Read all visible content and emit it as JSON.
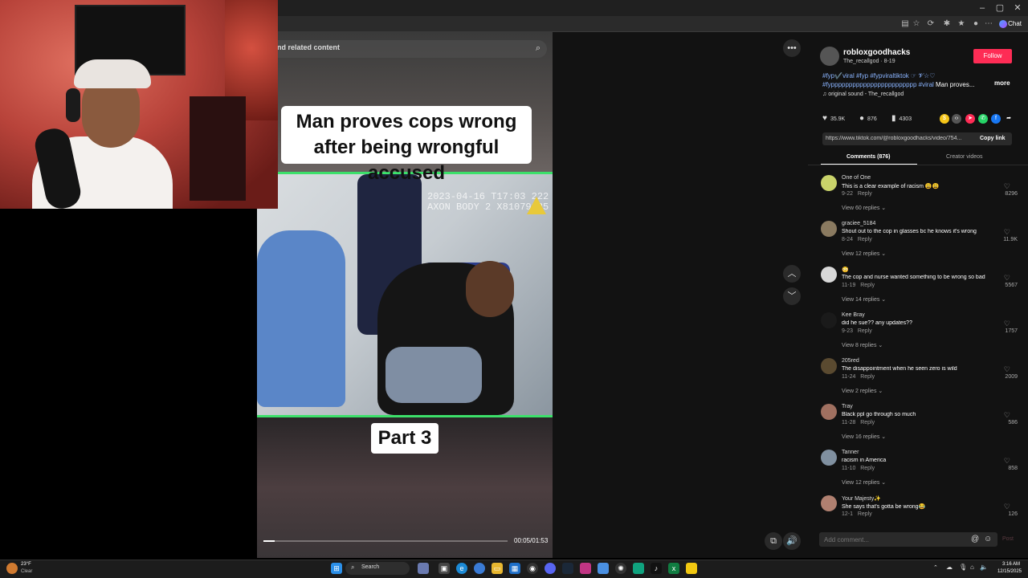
{
  "browser": {
    "chat_label": "Chat",
    "win_minimize": "–",
    "win_maximize": "▢",
    "win_close": "✕"
  },
  "search": {
    "label": "nd related content"
  },
  "video": {
    "caption_top": "Man proves cops wrong after being wrongful accused",
    "caption_bottom": "Part 3",
    "camera_stamp_line1": "2023-04-16  T17:03 222",
    "camera_stamp_line2": "AXON BODY 2  X81079335",
    "timecode": "00:05/01:53",
    "progress_fraction": 0.045
  },
  "author": {
    "name": "robloxgoodhacks",
    "sub": "The_recallgod · 8-19",
    "follow_label": "Follow"
  },
  "description": {
    "tags_line1": "#fyp✔️viral #fyp #fypviraltiktok ☞ 𝓥☆♡",
    "tags_line2": "#fypppppppppppppppppppppppp #viral",
    "tail": " Man proves...",
    "more": "more"
  },
  "sound": "♫  original sound - The_recallgod",
  "stats": {
    "likes": "35.9K",
    "comments": "876",
    "saves": "4303"
  },
  "share": {
    "url": "https://www.tiktok.com/@robloxgoodhacks/video/754...",
    "copy_label": "Copy link"
  },
  "tabs": {
    "comments": "Comments (876)",
    "creator": "Creator videos"
  },
  "comments": [
    {
      "user": "One of One",
      "text": "This is a clear example of racism 😩😩",
      "date": "9-22",
      "reply": "Reply",
      "replies": "View 60 replies ⌄",
      "likes": "8296",
      "avatar_color": "#c9d36a"
    },
    {
      "user": "graciee_5184",
      "text": "Shout out to the cop in glasses bc he knows it's wrong",
      "date": "8-24",
      "reply": "Reply",
      "replies": "View 12 replies ⌄",
      "likes": "11.9K",
      "avatar_color": "#8a7a60"
    },
    {
      "user": "😳",
      "text": "The cop and nurse wanted something to be wrong so bad",
      "date": "11-19",
      "reply": "Reply",
      "replies": "View 14 replies ⌄",
      "likes": "5567",
      "avatar_color": "#d8d8d8"
    },
    {
      "user": "Kee Bray",
      "text": "did he sue?? any updates??",
      "date": "9-23",
      "reply": "Reply",
      "replies": "View 8 replies ⌄",
      "likes": "1757",
      "avatar_color": "#1a1a1a"
    },
    {
      "user": "205red",
      "text": "The disappointment when he seen zero is wild",
      "date": "11-24",
      "reply": "Reply",
      "replies": "View 2 replies ⌄",
      "likes": "2009",
      "avatar_color": "#5a4a30"
    },
    {
      "user": "Tray",
      "text": "Black ppl go through so much",
      "date": "11-28",
      "reply": "Reply",
      "replies": "View 16 replies ⌄",
      "likes": "586",
      "avatar_color": "#a07060"
    },
    {
      "user": "Tanner",
      "text": "racism in America",
      "date": "11-10",
      "reply": "Reply",
      "replies": "View 12 replies ⌄",
      "likes": "858",
      "avatar_color": "#8090a0"
    },
    {
      "user": "Your Majesty✨",
      "text": "She says that's gotta be wrong😂",
      "date": "12-1",
      "reply": "Reply",
      "replies": "",
      "likes": "126",
      "avatar_color": "#b08070"
    }
  ],
  "comment_input": {
    "placeholder": "Add comment...",
    "post": "Post"
  },
  "taskbar": {
    "search": "Search",
    "weather_temp": "23°F",
    "weather_cond": "Clear",
    "time": "3:16 AM",
    "date": "12/15/2025"
  },
  "colors": {
    "accent": "#fe2c55",
    "progress_green": "#3ce06a",
    "link": "#8ab4ff"
  }
}
